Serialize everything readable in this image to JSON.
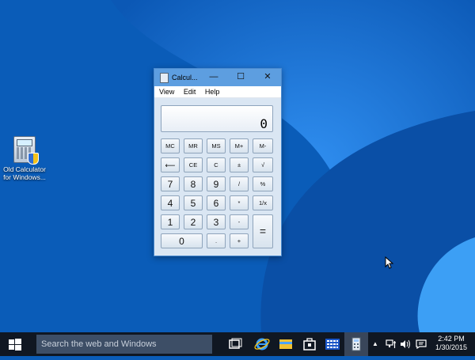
{
  "desktop": {
    "icon_label_line1": "Old Calculator",
    "icon_label_line2": "for Windows..."
  },
  "window": {
    "title": "Calcul...",
    "minimize": "—",
    "maximize": "☐",
    "close": "✕",
    "menu": [
      "View",
      "Edit",
      "Help"
    ],
    "display": "0"
  },
  "keys": {
    "mc": "MC",
    "mr": "MR",
    "ms": "MS",
    "mplus": "M+",
    "mminus": "M-",
    "back": "⟵",
    "ce": "CE",
    "c": "C",
    "pm": "±",
    "sqrt": "√",
    "k7": "7",
    "k8": "8",
    "k9": "9",
    "div": "/",
    "pct": "%",
    "k4": "4",
    "k5": "5",
    "k6": "6",
    "mul": "*",
    "recip": "1/x",
    "k1": "1",
    "k2": "2",
    "k3": "3",
    "sub": "-",
    "eq": "=",
    "k0": "0",
    "dot": ".",
    "add": "+"
  },
  "taskbar": {
    "search_placeholder": "Search the web and Windows",
    "tray_up": "▲",
    "time": "2:42 PM",
    "date": "1/30/2015"
  },
  "colors": {
    "desktop_bg": "#0a5cb8",
    "taskbar_bg": "#101722",
    "titlebar": "#5d9ee0",
    "window_body": "#dae6f3"
  }
}
